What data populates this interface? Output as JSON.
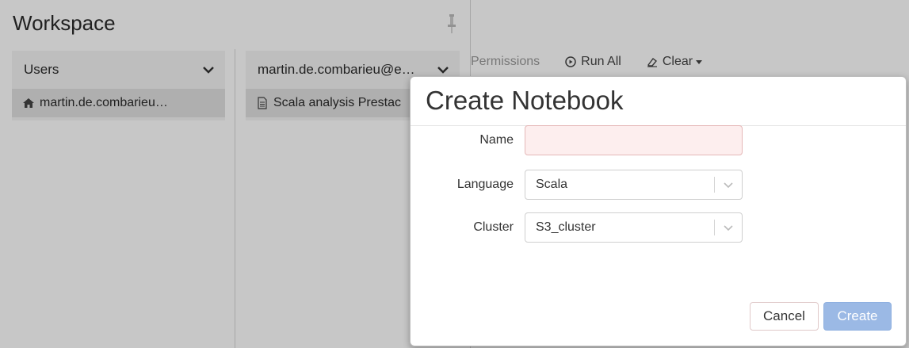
{
  "workspace": {
    "title": "Workspace",
    "columns": [
      {
        "header": "Users",
        "item": "martin.de.combarieu…"
      },
      {
        "header": "martin.de.combarieu@e…",
        "item": "Scala analysis Prestac"
      }
    ]
  },
  "toolbar": {
    "permissions_label": "Permissions",
    "run_all_label": "Run All",
    "clear_label": "Clear"
  },
  "modal": {
    "title": "Create Notebook",
    "name_label": "Name",
    "name_value": "",
    "language_label": "Language",
    "language_value": "Scala",
    "cluster_label": "Cluster",
    "cluster_value": "S3_cluster",
    "cancel_label": "Cancel",
    "create_label": "Create"
  },
  "colors": {
    "primary_disabled": "#9bb9e5",
    "invalid_input_bg": "#fdeeee"
  }
}
